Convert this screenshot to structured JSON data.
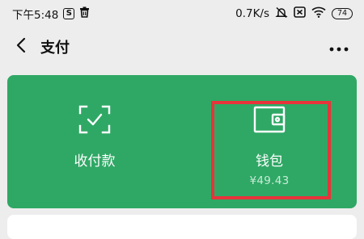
{
  "status_bar": {
    "time": "下午5:48",
    "app_badge": "S",
    "network_speed": "0.7K/s",
    "battery": "74"
  },
  "nav": {
    "title": "支付"
  },
  "pay_card": {
    "tiles": [
      {
        "label": "收付款",
        "icon": "scan-qr-icon"
      },
      {
        "label": "钱包",
        "sub": "¥49.43",
        "icon": "wallet-icon"
      }
    ],
    "accent": "#2fa865",
    "highlight": "#e8333a"
  }
}
